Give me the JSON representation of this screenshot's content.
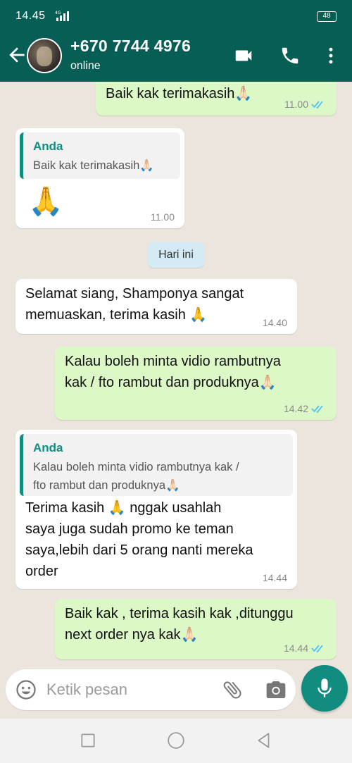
{
  "status_bar": {
    "time": "14.45",
    "network": "4G",
    "battery": "48"
  },
  "header": {
    "contact_name": "+670 7744 4976",
    "contact_status": "online",
    "icons": [
      "back-arrow-icon",
      "avatar",
      "video-call-icon",
      "phone-icon",
      "more-vert-icon"
    ]
  },
  "messages": [
    {
      "direction": "out",
      "text": "Baik kak terimakasih🙏🏻",
      "time": "11.00",
      "read": true
    },
    {
      "direction": "in",
      "quote": {
        "author": "Anda",
        "text": "Baik kak terimakasih🙏🏻"
      },
      "text": "🙏",
      "time": "11.00"
    },
    {
      "direction": "in",
      "text": "Selamat siang,  Shamponya sangat\nmemuaskan, terima kasih 🙏",
      "time": "14.40"
    },
    {
      "direction": "out",
      "text": "Kalau boleh minta vidio rambutnya\nkak / fto rambut dan produknya🙏🏻",
      "time": "14.42",
      "read": true
    },
    {
      "direction": "in",
      "quote": {
        "author": "Anda",
        "text": "Kalau boleh minta vidio rambutnya kak /\nfto rambut dan produknya🙏🏻"
      },
      "text": "Terima kasih 🙏 nggak usahlah\nsaya juga sudah promo ke teman\nsaya,lebih dari 5 orang nanti mereka\norder",
      "time": "14.44"
    },
    {
      "direction": "out",
      "text": "Baik kak , terima kasih kak ,ditunggu\nnext order nya kak🙏🏻",
      "time": "14.44",
      "read": true
    }
  ],
  "day_divider": "Hari ini",
  "composer": {
    "placeholder": "Ketik pesan"
  },
  "colors": {
    "header": "#075e54",
    "outgoing": "#dcf8c6",
    "incoming": "#ffffff",
    "accent": "#128c7e",
    "read_ticks": "#4fc3f7"
  }
}
